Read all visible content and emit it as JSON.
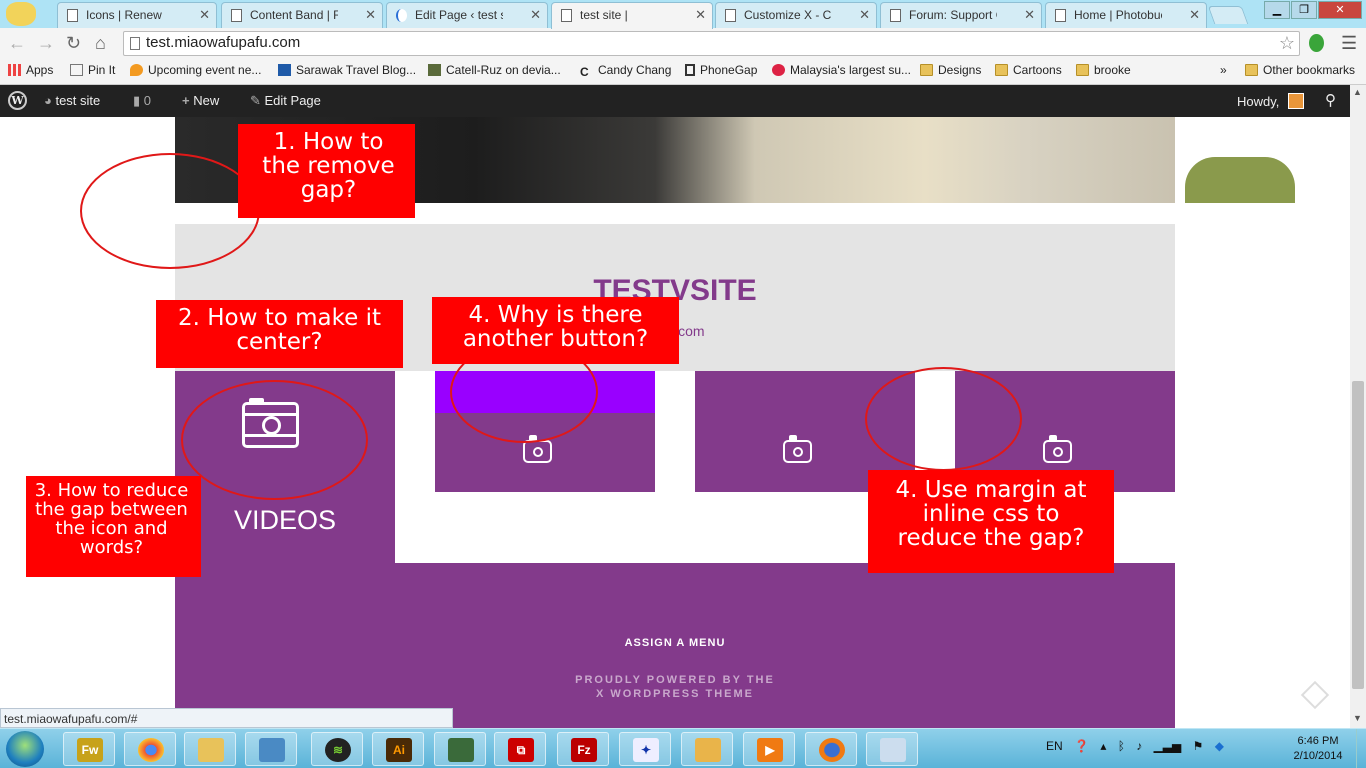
{
  "browser": {
    "tabs": [
      {
        "label": "Icons | Renew",
        "active": false
      },
      {
        "label": "Content Band | Rene",
        "active": false
      },
      {
        "label": "Edit Page ‹ test site —",
        "active": false
      },
      {
        "label": "test site |",
        "active": true
      },
      {
        "label": "Customize X - Child",
        "active": false
      },
      {
        "label": "Forum: Support Cent",
        "active": false
      },
      {
        "label": "Home | Photobucket",
        "active": false
      }
    ],
    "url": "test.miaowafupafu.com",
    "bookmarks": [
      "Apps",
      "Pin It",
      "Upcoming event ne...",
      "Sarawak Travel Blog...",
      "Catell-Ruz on devia...",
      "Candy Chang",
      "PhoneGap",
      "Malaysia's largest su...",
      "Designs",
      "Cartoons",
      "brooke",
      "»",
      "Other bookmarks"
    ],
    "status_url": "test.miaowafupafu.com/#"
  },
  "wp_admin": {
    "site_name": "test site",
    "comments": "0",
    "new_label": "New",
    "edit_label": "Edit Page",
    "howdy": "Howdy,"
  },
  "site": {
    "title": "TESTVSITE",
    "url_text": "vsite.com",
    "videos_label": "VIDEOS",
    "assign_menu": "ASSIGN A MENU",
    "powered_line1": "PROUDLY POWERED BY THE",
    "powered_line2": "X WORDPRESS THEME"
  },
  "annotations": [
    "1. How to the remove gap?",
    "2. How to make it center?",
    "3. How to reduce the gap between the icon and words?",
    "4. Why is there another button?",
    "4. Use margin at inline css to reduce the gap?"
  ],
  "taskbar": {
    "lang": "EN",
    "time": "6:46 PM",
    "date": "2/10/2014"
  },
  "colors": {
    "brand_purple": "#833a8b",
    "extra_button": "#9900ff",
    "annotation": "#ff0000"
  }
}
